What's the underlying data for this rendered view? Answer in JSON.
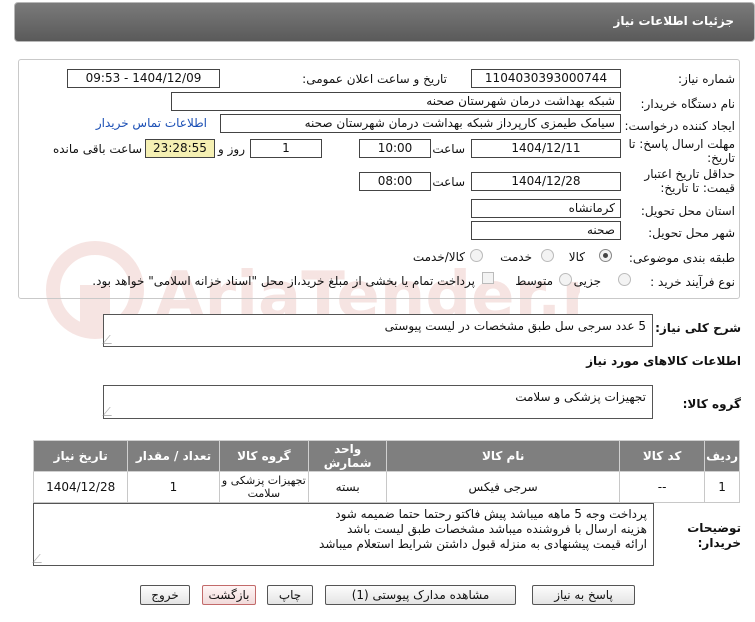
{
  "header": {
    "title": "جزئیات اطلاعات نیاز"
  },
  "watermark": {
    "text": "AriaTender.neT"
  },
  "form": {
    "need_number_label": "شماره نیاز:",
    "need_number": "1104030393000744",
    "announce_label": "تاریخ و ساعت اعلان عمومی:",
    "announce_value": "1404/12/09 - 09:53",
    "buyer_org_label": "نام دستگاه خریدار:",
    "buyer_org": "شبکه بهداشت درمان شهرستان صحنه",
    "requester_label": "ایجاد کننده درخواست:",
    "requester": "سیامک طیمزی کارپرداز شبکه بهداشت درمان شهرستان صحنه",
    "contact_link": "اطلاعات تماس خریدار",
    "deadline_label_1": "مهلت ارسال پاسخ: تا",
    "deadline_label_2": "تاریخ:",
    "deadline_date": "1404/12/11",
    "time_label": "ساعت",
    "deadline_time": "10:00",
    "days_value": "1",
    "days_label": "روز و",
    "remaining_time": "23:28:55",
    "remaining_label": "ساعت باقی مانده",
    "validity_label_1": "حداقل تاریخ اعتبار",
    "validity_label_2": "قیمت: تا تاریخ:",
    "validity_date": "1404/12/28",
    "validity_time_label": "ساعت",
    "validity_time": "08:00",
    "province_label": "استان محل تحویل:",
    "province": "کرمانشاه",
    "city_label": "شهر محل تحویل:",
    "city": "صحنه",
    "category_label": "طبقه بندی موضوعی:",
    "category_options": [
      "کالا",
      "خدمت",
      "کالا/خدمت"
    ],
    "process_label": "نوع فرآیند خرید :",
    "process_options": [
      "جزیی",
      "متوسط"
    ],
    "payment_note": "پرداخت تمام یا بخشی از مبلغ خرید،از محل \"اسناد خزانه اسلامی\" خواهد بود."
  },
  "summary": {
    "label": "شرح کلی نیاز:",
    "value": "5 عدد سرجی سل طبق مشخصات در لیست پیوستی"
  },
  "goods_info_title": "اطلاعات کالاهای مورد نیاز",
  "goods_group": {
    "label": "گروه کالا:",
    "value": "تجهیزات پزشکی و سلامت"
  },
  "table": {
    "headers": [
      "ردیف",
      "کد کالا",
      "نام کالا",
      "واحد شمارش",
      "گروه کالا",
      "تعداد / مقدار",
      "تاریخ نیاز"
    ],
    "rows": [
      [
        "1",
        "--",
        "سرجی فیکس",
        "بسته",
        "تجهیزات پزشکی و سلامت",
        "1",
        "1404/12/28"
      ]
    ]
  },
  "buyer_notes": {
    "label_1": "توضیحات",
    "label_2": "خریدار:",
    "lines": [
      "پرداخت وجه 5 ماهه میباشد پیش فاکتو رحتما حتما ضمیمه شود",
      "هزینه ارسال با فروشنده میباشد مشخصات طبق لیست باشد",
      "ارائه قیمت پیشنهادی به منزله قبول داشتن شرایط استعلام میباشد"
    ]
  },
  "buttons": {
    "reply": "پاسخ به نیاز",
    "attachments": "مشاهده مدارک پیوستی (1)",
    "print": "چاپ",
    "back": "بازگشت",
    "exit": "خروج"
  }
}
